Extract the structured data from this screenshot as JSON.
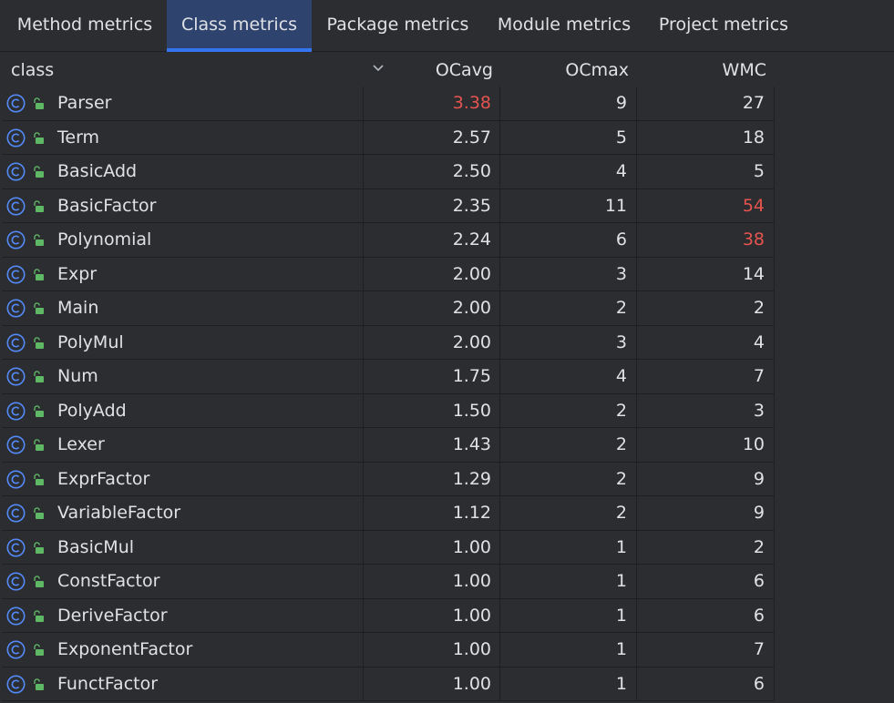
{
  "tabs": [
    {
      "label": "Method metrics",
      "active": false
    },
    {
      "label": "Class metrics",
      "active": true
    },
    {
      "label": "Package metrics",
      "active": false
    },
    {
      "label": "Module metrics",
      "active": false
    },
    {
      "label": "Project metrics",
      "active": false
    }
  ],
  "table": {
    "columns": [
      "class",
      "OCavg",
      "OCmax",
      "WMC"
    ],
    "rows": [
      {
        "name": "Parser",
        "ocavg": "3.38",
        "ocmax": "9",
        "wmc": "27",
        "ocavg_warn": true,
        "wmc_warn": false
      },
      {
        "name": "Term",
        "ocavg": "2.57",
        "ocmax": "5",
        "wmc": "18",
        "ocavg_warn": false,
        "wmc_warn": false
      },
      {
        "name": "BasicAdd",
        "ocavg": "2.50",
        "ocmax": "4",
        "wmc": "5",
        "ocavg_warn": false,
        "wmc_warn": false
      },
      {
        "name": "BasicFactor",
        "ocavg": "2.35",
        "ocmax": "11",
        "wmc": "54",
        "ocavg_warn": false,
        "wmc_warn": true
      },
      {
        "name": "Polynomial",
        "ocavg": "2.24",
        "ocmax": "6",
        "wmc": "38",
        "ocavg_warn": false,
        "wmc_warn": true
      },
      {
        "name": "Expr",
        "ocavg": "2.00",
        "ocmax": "3",
        "wmc": "14",
        "ocavg_warn": false,
        "wmc_warn": false
      },
      {
        "name": "Main",
        "ocavg": "2.00",
        "ocmax": "2",
        "wmc": "2",
        "ocavg_warn": false,
        "wmc_warn": false
      },
      {
        "name": "PolyMul",
        "ocavg": "2.00",
        "ocmax": "3",
        "wmc": "4",
        "ocavg_warn": false,
        "wmc_warn": false
      },
      {
        "name": "Num",
        "ocavg": "1.75",
        "ocmax": "4",
        "wmc": "7",
        "ocavg_warn": false,
        "wmc_warn": false
      },
      {
        "name": "PolyAdd",
        "ocavg": "1.50",
        "ocmax": "2",
        "wmc": "3",
        "ocavg_warn": false,
        "wmc_warn": false
      },
      {
        "name": "Lexer",
        "ocavg": "1.43",
        "ocmax": "2",
        "wmc": "10",
        "ocavg_warn": false,
        "wmc_warn": false
      },
      {
        "name": "ExprFactor",
        "ocavg": "1.29",
        "ocmax": "2",
        "wmc": "9",
        "ocavg_warn": false,
        "wmc_warn": false
      },
      {
        "name": "VariableFactor",
        "ocavg": "1.12",
        "ocmax": "2",
        "wmc": "9",
        "ocavg_warn": false,
        "wmc_warn": false
      },
      {
        "name": "BasicMul",
        "ocavg": "1.00",
        "ocmax": "1",
        "wmc": "2",
        "ocavg_warn": false,
        "wmc_warn": false
      },
      {
        "name": "ConstFactor",
        "ocavg": "1.00",
        "ocmax": "1",
        "wmc": "6",
        "ocavg_warn": false,
        "wmc_warn": false
      },
      {
        "name": "DeriveFactor",
        "ocavg": "1.00",
        "ocmax": "1",
        "wmc": "6",
        "ocavg_warn": false,
        "wmc_warn": false
      },
      {
        "name": "ExponentFactor",
        "ocavg": "1.00",
        "ocmax": "1",
        "wmc": "7",
        "ocavg_warn": false,
        "wmc_warn": false
      },
      {
        "name": "FunctFactor",
        "ocavg": "1.00",
        "ocmax": "1",
        "wmc": "6",
        "ocavg_warn": false,
        "wmc_warn": false
      }
    ]
  },
  "icons": {
    "row_class_icon": "class-icon",
    "row_visibility_icon": "public-lock-icon",
    "sort_icon": "chevron-down-icon"
  },
  "colors": {
    "background": "#2b2d30",
    "active_tab_bg": "#2e436e",
    "active_tab_underline": "#3574f0",
    "warning_value": "#e5544f",
    "class_icon": "#548af7",
    "lock_icon": "#5fb865"
  }
}
